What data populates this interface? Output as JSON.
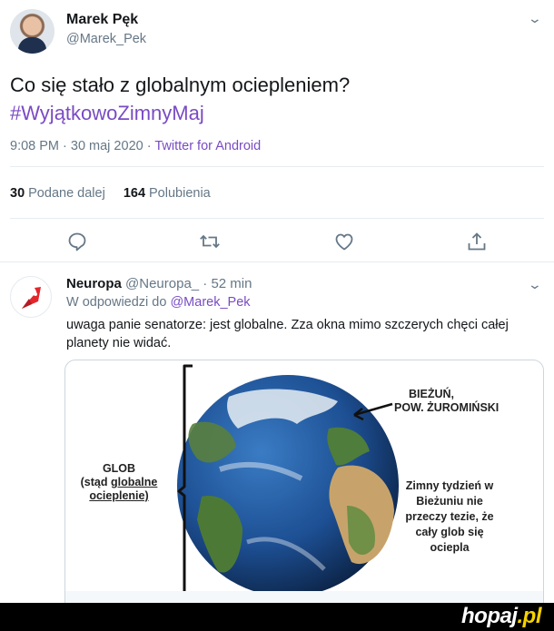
{
  "main_tweet": {
    "author_name": "Marek Pęk",
    "author_handle": "@Marek_Pek",
    "text_line": "Co się stało z globalnym ociepleniem?",
    "hashtag": "#WyjątkowoZimnyMaj",
    "timestamp": "9:08 PM · 30 maj 2020 · ",
    "source": "Twitter for Android",
    "retweets_count": "30",
    "retweets_label": "Podane dalej",
    "likes_count": "164",
    "likes_label": "Polubienia",
    "actions": [
      "reply-icon",
      "retweet-icon",
      "like-icon",
      "share-icon"
    ],
    "link_color": "#794bc4"
  },
  "reply_tweet": {
    "author_name": "Neuropa",
    "author_handle": "@Neuropa_",
    "time_ago": " · 52 min",
    "reply_prefix": "W odpowiedzi do ",
    "reply_to": "@Marek_Pek",
    "text": "uwaga panie senatorze: jest globalne. Zza okna mimo szczerych chęci całej planety nie widać.",
    "avatar_logo": "neuropa-rocket-logo",
    "image": {
      "label_glob": "GLOB",
      "label_glob_sub1": "(stąd ",
      "label_glob_sub_underlined": "globalne",
      "label_glob_sub2": "ocieplenie)",
      "label_place1": "BIEŻUŃ,",
      "label_place2": "POW. ŻUROMIŃSKI",
      "label_note": "Zimny tydzień w Bieżuniu nie przeczy tezie, że cały glob się ociepla"
    }
  },
  "watermark": {
    "brand": "hopaj",
    "suffix": ".pl"
  }
}
